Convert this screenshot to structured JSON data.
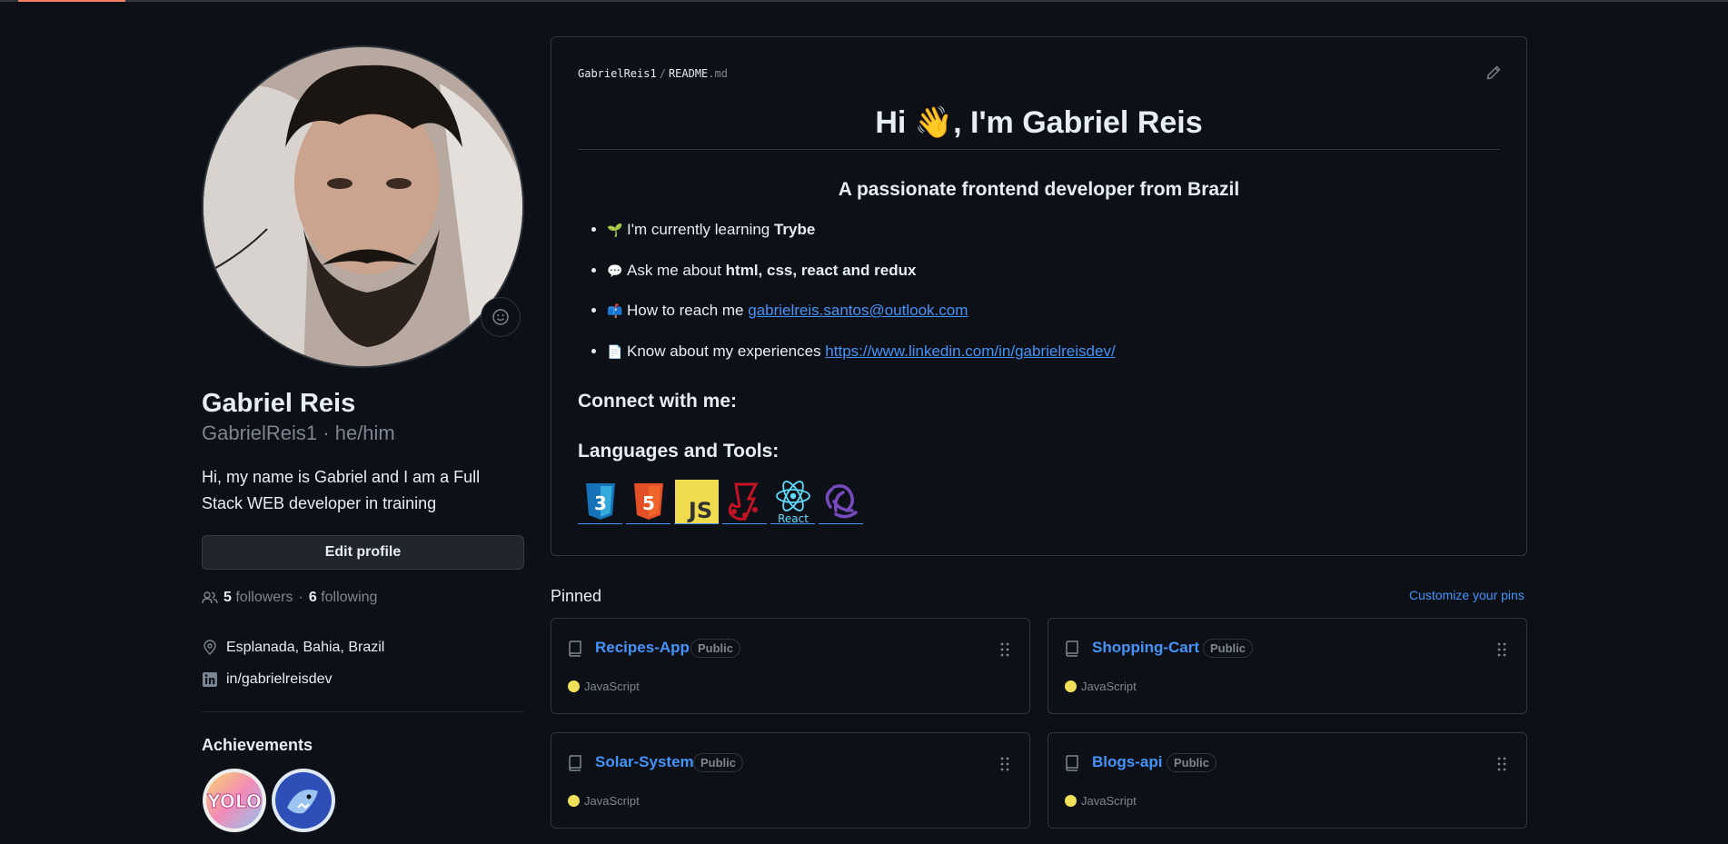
{
  "profile": {
    "full_name": "Gabriel Reis",
    "login_line": "GabrielReis1 · he/him",
    "bio": "Hi, my name is Gabriel and I am a Full Stack WEB developer in training",
    "edit_profile_label": "Edit profile",
    "followers_count": "5",
    "followers_label": "followers",
    "dot": "·",
    "following_count": "6",
    "following_label": "following",
    "location": "Esplanada, Bahia, Brazil",
    "linkedin": "in/gabrielreisdev",
    "achievements_title": "Achievements",
    "achievements": [
      "yolo-badge",
      "pull-shark-badge"
    ]
  },
  "readme": {
    "path_owner": "GabrielReis1",
    "path_sep": "/",
    "path_file": "README",
    "path_ext": ".md",
    "title": "Hi 👋, I'm Gabriel Reis",
    "subtitle": "A passionate frontend developer from Brazil",
    "items": [
      {
        "emoji": "🌱",
        "text": "I'm currently learning ",
        "bold": "Trybe",
        "link": ""
      },
      {
        "emoji": "💬",
        "text": "Ask me about ",
        "bold": "html, css, react and redux",
        "link": ""
      },
      {
        "emoji": "📫",
        "text": "How to reach me ",
        "bold": "",
        "link": "gabrielreis.santos@outlook.com"
      },
      {
        "emoji": "📄",
        "text": "Know about my experiences ",
        "bold": "",
        "link": "https://www.linkedin.com/in/gabrielreisdev/"
      }
    ],
    "connect_title": "Connect with me:",
    "tools_title": "Languages and Tools:",
    "tools": [
      "css3-icon",
      "html5-icon",
      "javascript-icon",
      "jest-icon",
      "react-icon",
      "redux-icon"
    ],
    "react_caption": "React",
    "css_caption": "3",
    "html_caption": "5",
    "js_caption": "JS"
  },
  "pinned": {
    "title": "Pinned",
    "customize_label": "Customize your pins",
    "repos": [
      {
        "name": "Recipes-App",
        "visibility": "Public",
        "language": "JavaScript",
        "language_color": "#f1e05a"
      },
      {
        "name": "Shopping-Cart",
        "visibility": "Public",
        "language": "JavaScript",
        "language_color": "#f1e05a"
      },
      {
        "name": "Solar-System",
        "visibility": "Public",
        "language": "JavaScript",
        "language_color": "#f1e05a"
      },
      {
        "name": "Blogs-api",
        "visibility": "Public",
        "language": "JavaScript",
        "language_color": "#f1e05a"
      }
    ]
  },
  "colors": {
    "background": "#0d1117",
    "border": "#30363d",
    "link": "#4493f8",
    "muted": "#7d8590"
  }
}
